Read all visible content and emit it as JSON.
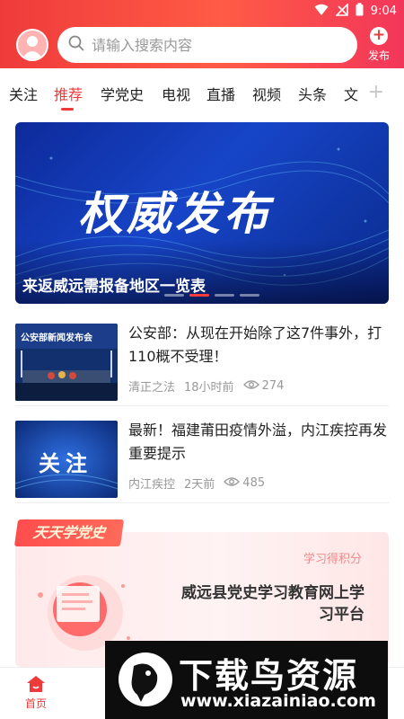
{
  "status_bar": {
    "time": "9:04"
  },
  "search": {
    "placeholder": "请输入搜索内容"
  },
  "publish": {
    "label": "发布"
  },
  "tabs": [
    {
      "label": "关注"
    },
    {
      "label": "推荐"
    },
    {
      "label": "学党史"
    },
    {
      "label": "电视"
    },
    {
      "label": "直播"
    },
    {
      "label": "视频"
    },
    {
      "label": "头条"
    },
    {
      "label": "文"
    }
  ],
  "banner": {
    "image_text": "权威发布",
    "caption": "来返威远需报备地区一览表"
  },
  "news": [
    {
      "title": "公安部：从现在开始除了这7件事外，打110概不受理！",
      "source": "清正之法",
      "time": "18小时前",
      "views": "274",
      "thumb_text": "公安部新闻发布会"
    },
    {
      "title": "最新！福建莆田疫情外溢，内江疾控再发重要提示",
      "source": "内江疾控",
      "time": "2天前",
      "views": "485",
      "thumb_text": "关注"
    }
  ],
  "study_card": {
    "tag": "天天学党史",
    "points_label": "学习得积分",
    "title": "威远县党史学习教育网上学习平台"
  },
  "bottom_nav": {
    "home_label": "首页"
  },
  "watermark": {
    "brand": "下载鸟资源",
    "url": "www.xiazainiao.com"
  },
  "colors": {
    "accent": "#ee3a3a",
    "header_gradient_start": "#ef3b3b",
    "header_gradient_end": "#f2365a"
  }
}
